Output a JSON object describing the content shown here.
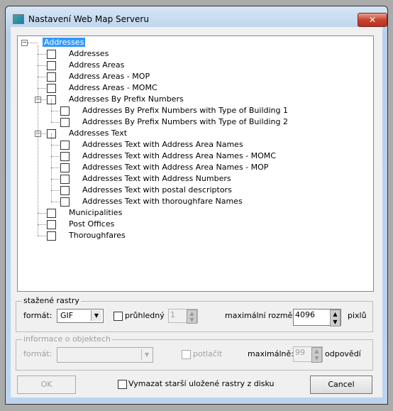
{
  "window": {
    "title": "Nastavení Web Map Serveru",
    "close": "✕"
  },
  "tree": {
    "root": "Addresses",
    "items": [
      {
        "label": "Addresses",
        "level": 1
      },
      {
        "label": "Address Areas",
        "level": 1
      },
      {
        "label": "Address Areas - MOP",
        "level": 1
      },
      {
        "label": "Address Areas - MOMC",
        "level": 1
      },
      {
        "label": "Addresses By Prefix Numbers",
        "level": 1,
        "expanded": true
      },
      {
        "label": "Addresses By Prefix Numbers with Type of Building 1",
        "level": 2
      },
      {
        "label": "Addresses By Prefix Numbers with Type of Building 2",
        "level": 2
      },
      {
        "label": "Addresses Text",
        "level": 1,
        "expanded": true
      },
      {
        "label": "Addresses Text with Address Area Names",
        "level": 2
      },
      {
        "label": "Addresses Text with Address Area Names - MOMC",
        "level": 2
      },
      {
        "label": "Addresses Text with Address Area Names - MOP",
        "level": 2
      },
      {
        "label": "Addresses Text with Address Numbers",
        "level": 2
      },
      {
        "label": "Addresses Text with postal descriptors",
        "level": 2
      },
      {
        "label": "Addresses Text with thoroughfare Names",
        "level": 2
      },
      {
        "label": "Municipalities",
        "level": 1
      },
      {
        "label": "Post Offices",
        "level": 1
      },
      {
        "label": "Thoroughfares",
        "level": 1
      }
    ]
  },
  "rasters": {
    "legend": "stažené rastry",
    "format_label": "formát:",
    "format_value": "GIF",
    "transparent_label": "průhledný",
    "transparent_value": "1",
    "max_size_label": "maximální rozměr:",
    "max_size_value": "4096",
    "unit": "pixlů"
  },
  "objects": {
    "legend": "informace o objektech",
    "format_label": "formát:",
    "suppress_label": "potlačit",
    "max_label": "maximálně:",
    "max_value": "99",
    "unit": "odpovědí"
  },
  "footer": {
    "ok": "OK",
    "delete_label": "Vymazat starší uložené rastry z disku",
    "cancel": "Cancel"
  }
}
